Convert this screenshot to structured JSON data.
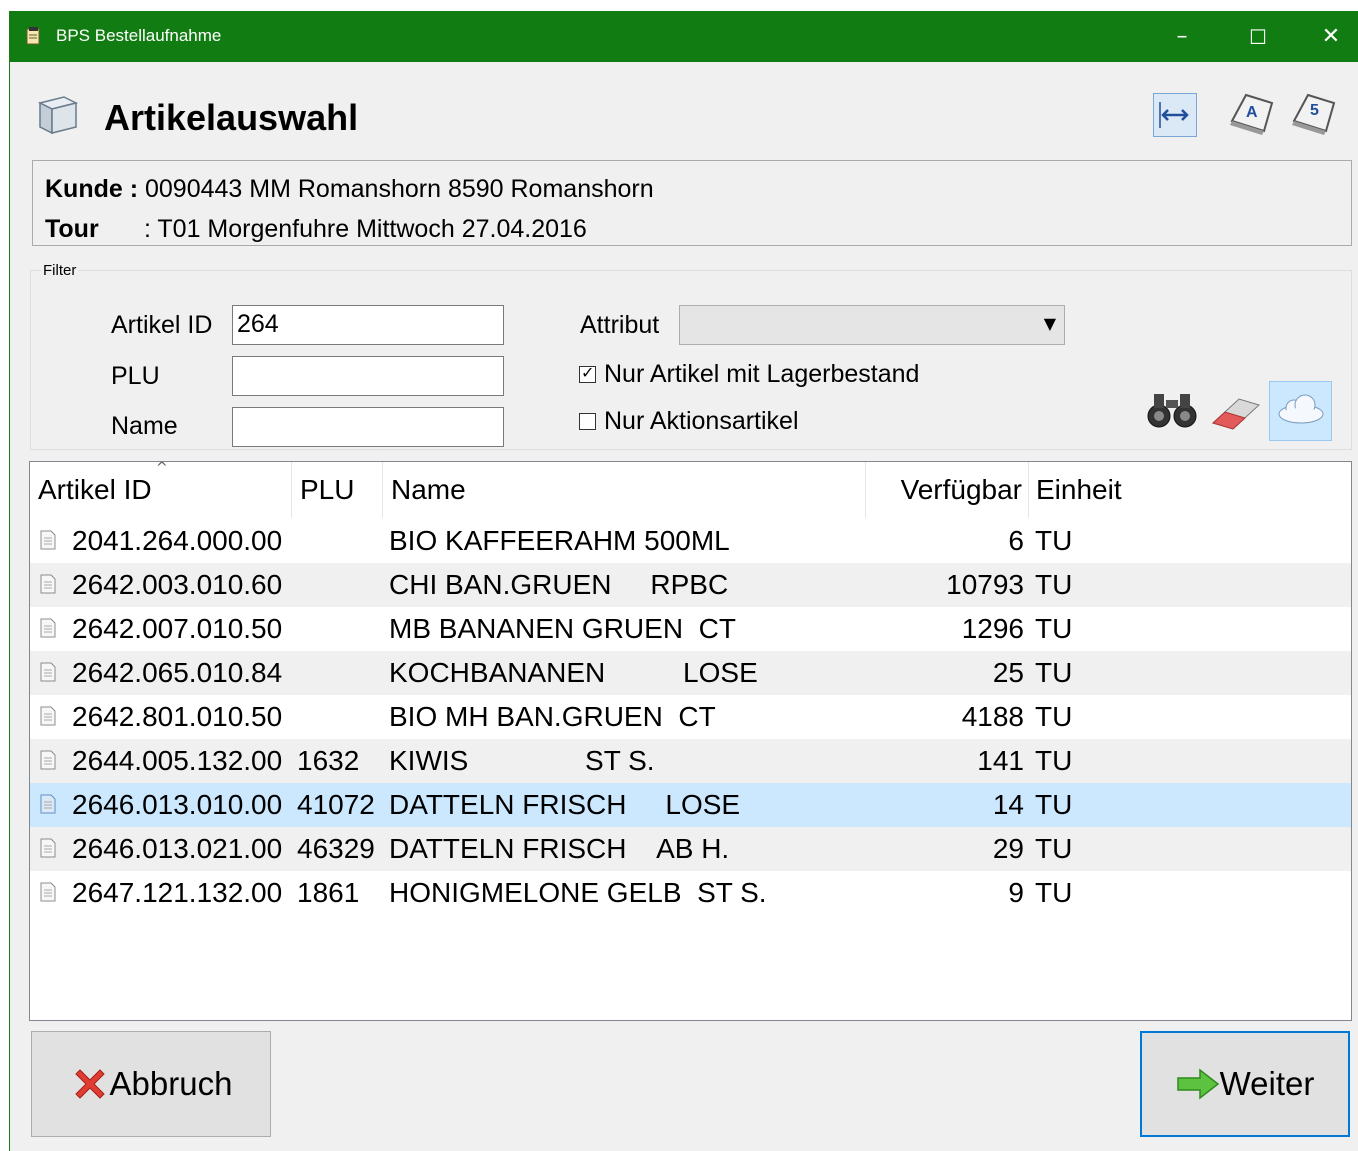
{
  "window": {
    "title": "BPS Bestellaufnahme",
    "minimize": "–",
    "maximize": "☐",
    "close": "✕"
  },
  "header": {
    "title": "Artikelauswahl"
  },
  "info": {
    "kunde_label": "Kunde :",
    "kunde_value": "0090443 MM Romanshorn 8590 Romanshorn",
    "tour_label": "Tour",
    "tour_value": ": T01 Morgenfuhre Mittwoch 27.04.2016"
  },
  "filter": {
    "legend": "Filter",
    "artikel_id_label": "Artikel ID",
    "artikel_id_value": "264",
    "plu_label": "PLU",
    "plu_value": "",
    "name_label": "Name",
    "name_value": "",
    "attribut_label": "Attribut",
    "attribut_value": "",
    "lager_label": "Nur Artikel mit Lagerbestand",
    "lager_checked": true,
    "aktion_label": "Nur Aktionsartikel",
    "aktion_checked": false
  },
  "table": {
    "columns": [
      "Artikel ID",
      "PLU",
      "Name",
      "Verfügbar",
      "Einheit"
    ],
    "rows": [
      {
        "id": "2041.264.000.00",
        "plu": "",
        "name": "BIO KAFFEERAHM 500ML",
        "qty": "6",
        "unit": "TU"
      },
      {
        "id": "2642.003.010.60",
        "plu": "",
        "name": "CHI BAN.GRUEN     RPBC",
        "qty": "10793",
        "unit": "TU"
      },
      {
        "id": "2642.007.010.50",
        "plu": "",
        "name": "MB BANANEN GRUEN  CT",
        "qty": "1296",
        "unit": "TU"
      },
      {
        "id": "2642.065.010.84",
        "plu": "",
        "name": "KOCHBANANEN          LOSE",
        "qty": "25",
        "unit": "TU"
      },
      {
        "id": "2642.801.010.50",
        "plu": "",
        "name": "BIO MH BAN.GRUEN  CT",
        "qty": "4188",
        "unit": "TU"
      },
      {
        "id": "2644.005.132.00",
        "plu": "1632",
        "name": "KIWIS               ST S.",
        "qty": "141",
        "unit": "TU"
      },
      {
        "id": "2646.013.010.00",
        "plu": "41072",
        "name": "DATTELN FRISCH     LOSE",
        "qty": "14",
        "unit": "TU"
      },
      {
        "id": "2646.013.021.00",
        "plu": "46329",
        "name": "DATTELN FRISCH    AB H.",
        "qty": "29",
        "unit": "TU"
      },
      {
        "id": "2647.121.132.00",
        "plu": "1861",
        "name": "HONIGMELONE GELB  ST S.",
        "qty": "9",
        "unit": "TU"
      }
    ],
    "selected_index": 6
  },
  "buttons": {
    "cancel": "Abbruch",
    "next": "Weiter"
  },
  "colors": {
    "titlebar": "#117c11",
    "selection": "#cce8ff",
    "focus_border": "#0078d7"
  }
}
